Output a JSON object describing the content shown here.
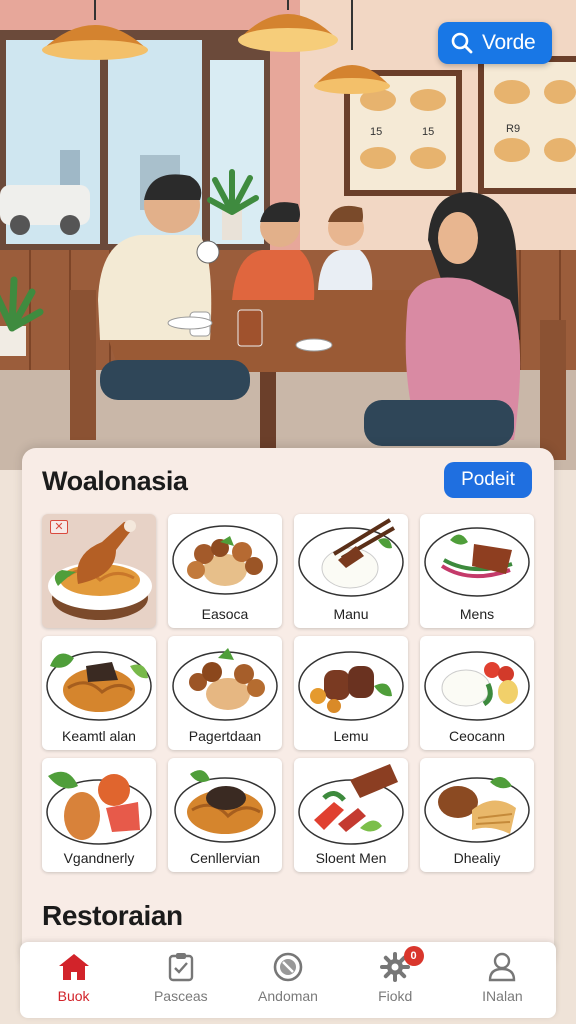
{
  "header": {
    "search_label": "Vorde",
    "icon": "search-icon"
  },
  "menu_card": {
    "title": "Woalonasia",
    "action_label": "Podeit",
    "items": [
      {
        "label": "",
        "featured": true,
        "favorite": true
      },
      {
        "label": "Easoca"
      },
      {
        "label": "Manu"
      },
      {
        "label": "Mens"
      },
      {
        "label": "Keamtl alan"
      },
      {
        "label": "Pagertdaan"
      },
      {
        "label": "Lemu"
      },
      {
        "label": "Ceocann"
      },
      {
        "label": "Vgandnerly"
      },
      {
        "label": "Cenllervian"
      },
      {
        "label": "Sloent Men"
      },
      {
        "label": "Dhealiy"
      }
    ],
    "section_title": "Restoraian"
  },
  "wall_menu": {
    "prices": [
      "15",
      "15",
      "R9"
    ]
  },
  "bottom_nav": {
    "items": [
      {
        "label": "Buok",
        "icon": "home-icon",
        "active": true
      },
      {
        "label": "Pasceas",
        "icon": "clipboard-icon"
      },
      {
        "label": "Andoman",
        "icon": "compass-icon"
      },
      {
        "label": "Fiokd",
        "icon": "gear-icon",
        "badge": "0"
      },
      {
        "label": "INalan",
        "icon": "user-icon"
      }
    ]
  },
  "colors": {
    "accent": "#1f6fe0",
    "active_nav": "#d2232a",
    "card_bg": "#f8ece6",
    "badge": "#d9362c"
  }
}
